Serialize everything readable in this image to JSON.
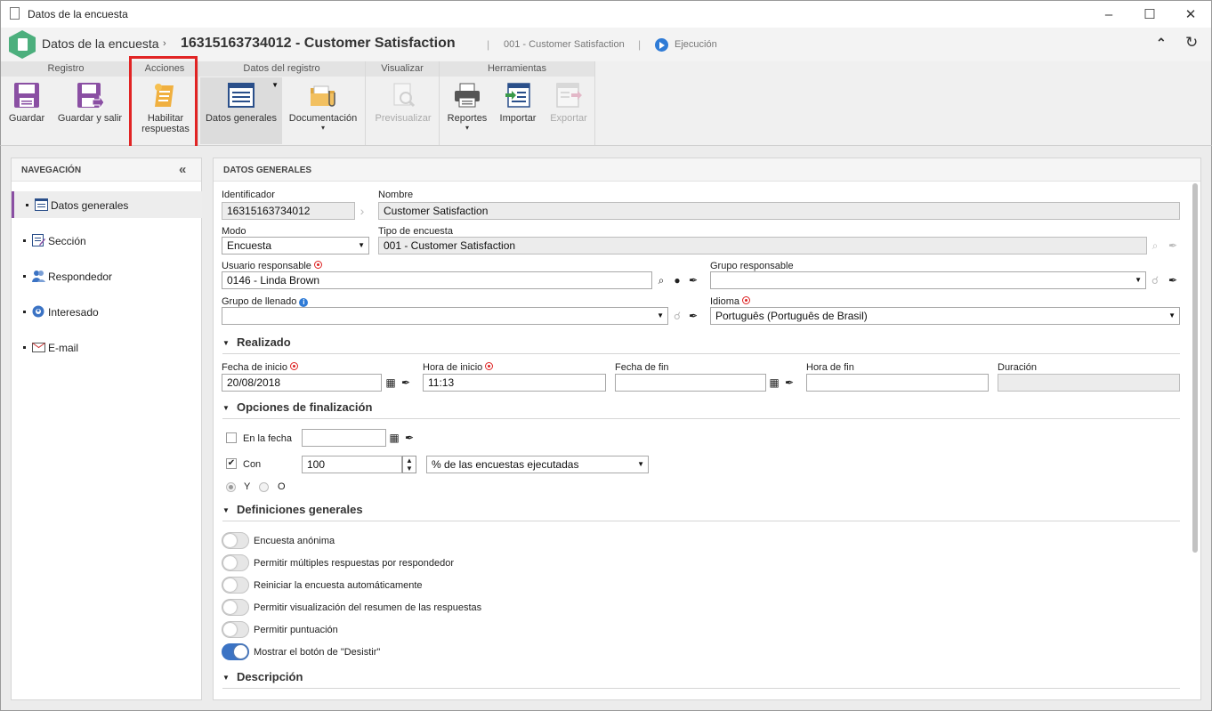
{
  "window": {
    "title": "Datos de la encuesta"
  },
  "header": {
    "breadcrumb": "Datos de la encuesta",
    "title": "16315163734012 - Customer Satisfaction",
    "sep": "|",
    "subtitle": "001 - Customer Satisfaction",
    "status": "Ejecución"
  },
  "ribbon": {
    "groups": {
      "registro": "Registro",
      "acciones": "Acciones",
      "datos": "Datos del registro",
      "visualizar": "Visualizar",
      "herramientas": "Herramientas"
    },
    "buttons": {
      "guardar": "Guardar",
      "guardar_salir": "Guardar y salir",
      "habilitar1": "Habilitar",
      "habilitar2": "respuestas",
      "datos_generales": "Datos generales",
      "documentacion": "Documentación",
      "previsualizar": "Previsualizar",
      "reportes": "Reportes",
      "importar": "Importar",
      "exportar": "Exportar"
    },
    "caret": "▾"
  },
  "nav": {
    "title": "NAVEGACIÓN",
    "items": [
      "Datos generales",
      "Sección",
      "Respondedor",
      "Interesado",
      "E-mail"
    ]
  },
  "content": {
    "title": "DATOS GENERALES",
    "identificador": {
      "label": "Identificador",
      "value": "16315163734012"
    },
    "nombre": {
      "label": "Nombre",
      "value": "Customer Satisfaction"
    },
    "modo": {
      "label": "Modo",
      "value": "Encuesta"
    },
    "tipo": {
      "label": "Tipo de encuesta",
      "value": "001 - Customer Satisfaction"
    },
    "usuario": {
      "label": "Usuario responsable",
      "value": "0146 - Linda Brown"
    },
    "grupo_resp": {
      "label": "Grupo responsable",
      "value": ""
    },
    "grupo_llenado": {
      "label": "Grupo de llenado",
      "value": ""
    },
    "idioma": {
      "label": "Idioma",
      "value": "Português (Português de Brasil)"
    },
    "realizado": {
      "title": "Realizado",
      "fecha_inicio": {
        "label": "Fecha de inicio",
        "value": "20/08/2018"
      },
      "hora_inicio": {
        "label": "Hora de inicio",
        "value": "11:13"
      },
      "fecha_fin": {
        "label": "Fecha de fin",
        "value": ""
      },
      "hora_fin": {
        "label": "Hora de fin",
        "value": ""
      },
      "duracion": {
        "label": "Duración",
        "value": ""
      }
    },
    "finalizacion": {
      "title": "Opciones de finalización",
      "en_fecha": {
        "label": "En la fecha",
        "checked": false,
        "value": ""
      },
      "con": {
        "label": "Con",
        "checked": true,
        "value": "100",
        "select": "% de las encuestas ejecutadas"
      },
      "y": "Y",
      "o": "O"
    },
    "definiciones": {
      "title": "Definiciones generales",
      "toggles": [
        {
          "label": "Encuesta anónima",
          "on": false
        },
        {
          "label": "Permitir múltiples respuestas por respondedor",
          "on": false
        },
        {
          "label": "Reiniciar la encuesta automáticamente",
          "on": false
        },
        {
          "label": "Permitir visualización del resumen de las respuestas",
          "on": false
        },
        {
          "label": "Permitir puntuación",
          "on": false
        },
        {
          "label": "Mostrar el botón de \"Desistir\"",
          "on": true
        }
      ]
    },
    "descripcion": {
      "title": "Descripción"
    }
  },
  "colors": {
    "accent": "#3b73c4",
    "nav_active": "#8a4fa3",
    "highlight": "#e12424",
    "brand": "#4caf7d"
  }
}
